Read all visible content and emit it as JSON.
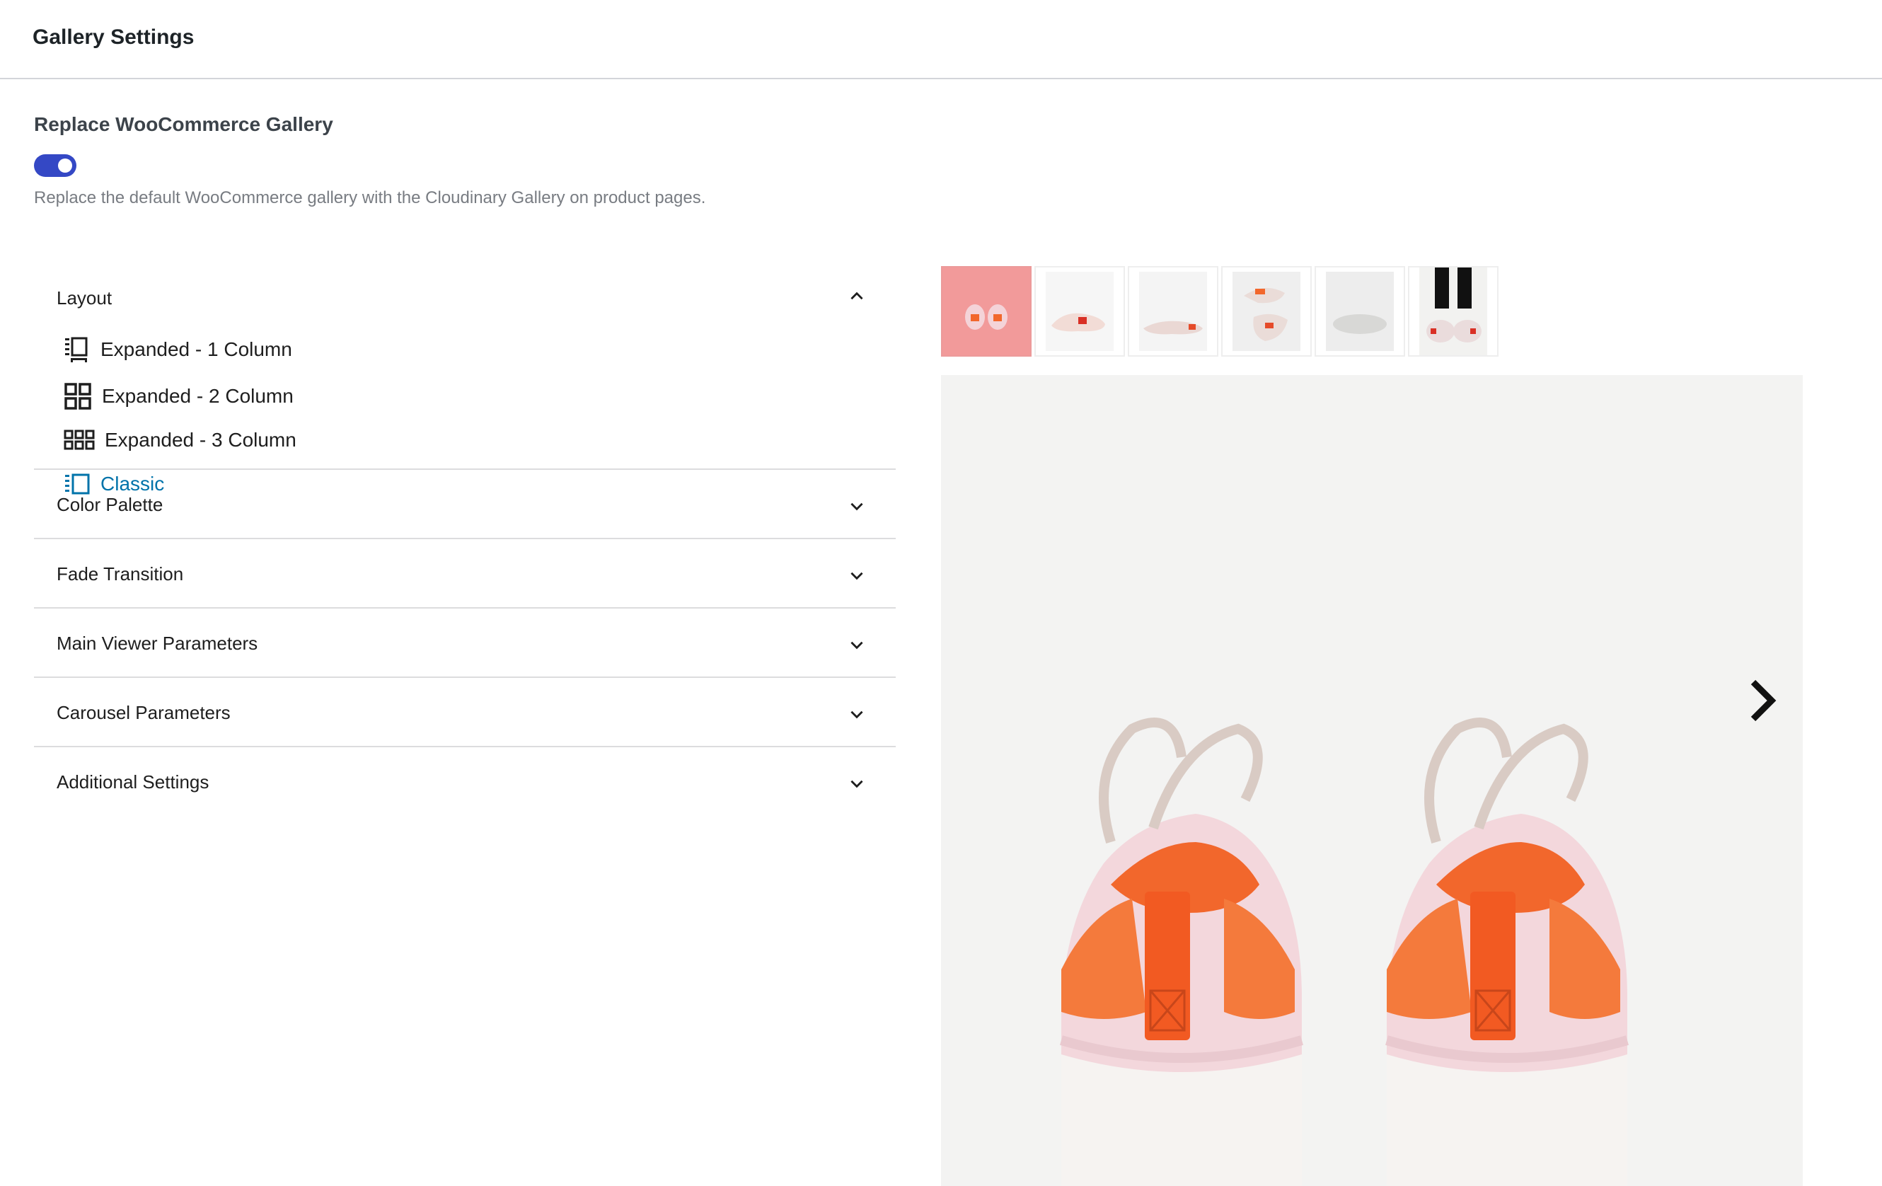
{
  "header": {
    "title": "Gallery Settings"
  },
  "replace_gallery": {
    "title": "Replace WooCommerce Gallery",
    "enabled": true,
    "help": "Replace the default WooCommerce gallery with the Cloudinary Gallery on product pages."
  },
  "accordion": {
    "layout": {
      "label": "Layout",
      "expanded": true,
      "options": [
        {
          "label": "Expanded - 1 Column",
          "icon": "expanded-1-column-icon",
          "selected": false
        },
        {
          "label": "Expanded - 2 Column",
          "icon": "expanded-2-column-icon",
          "selected": false
        },
        {
          "label": "Expanded - 3 Column",
          "icon": "expanded-3-column-icon",
          "selected": false
        },
        {
          "label": "Classic",
          "icon": "classic-layout-icon",
          "selected": true
        }
      ]
    },
    "sections": [
      {
        "label": "Color Palette",
        "expanded": false
      },
      {
        "label": "Fade Transition",
        "expanded": false
      },
      {
        "label": "Main Viewer Parameters",
        "expanded": false
      },
      {
        "label": "Carousel Parameters",
        "expanded": false
      },
      {
        "label": "Additional Settings",
        "expanded": false
      }
    ]
  },
  "gallery": {
    "thumbnail_count": 6,
    "selected_thumbnail": 1,
    "next_icon": "chevron-right-icon"
  },
  "colors": {
    "accent": "#3448c5",
    "active_link": "#0073aa",
    "shoe_pink": "#f3cfd6",
    "shoe_orange": "#f2672c",
    "thumb_bg_pink": "#f29a9a"
  }
}
